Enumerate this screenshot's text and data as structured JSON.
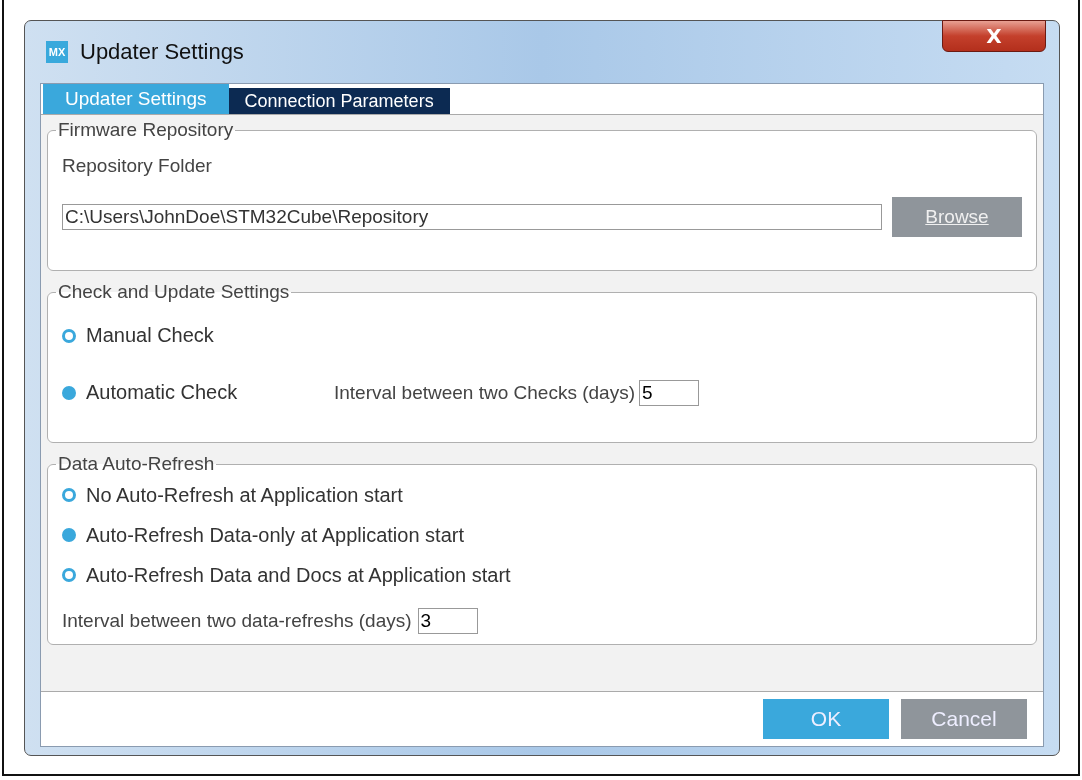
{
  "window": {
    "title": "Updater Settings",
    "app_icon": "MX",
    "close": "X"
  },
  "tabs": [
    {
      "label": "Updater Settings",
      "selected": true
    },
    {
      "label": "Connection Parameters",
      "selected": false
    }
  ],
  "firmware_repository": {
    "title": "Firmware Repository",
    "label": "Repository Folder",
    "value": "C:\\Users\\JohnDoe\\STM32Cube\\Repository",
    "button": "Browse"
  },
  "check_settings": {
    "title": "Check and Update Settings",
    "options": [
      {
        "label": "Manual Check",
        "selected": false
      },
      {
        "label": "Automatic Check",
        "selected": true
      }
    ],
    "interval_label": "Interval between two Checks (days)",
    "interval_value": "5"
  },
  "data_refresh": {
    "title": "Data Auto-Refresh",
    "options": [
      {
        "label": "No Auto-Refresh at Application start",
        "selected": false
      },
      {
        "label": "Auto-Refresh Data-only at Application start",
        "selected": true
      },
      {
        "label": "Auto-Refresh Data and Docs at Application start",
        "selected": false
      }
    ],
    "interval_label": "Interval between two data-refreshs (days)",
    "interval_value": "3"
  },
  "buttons": [
    {
      "label": "OK",
      "kind": "primary"
    },
    {
      "label": "Cancel",
      "kind": "secondary"
    }
  ]
}
